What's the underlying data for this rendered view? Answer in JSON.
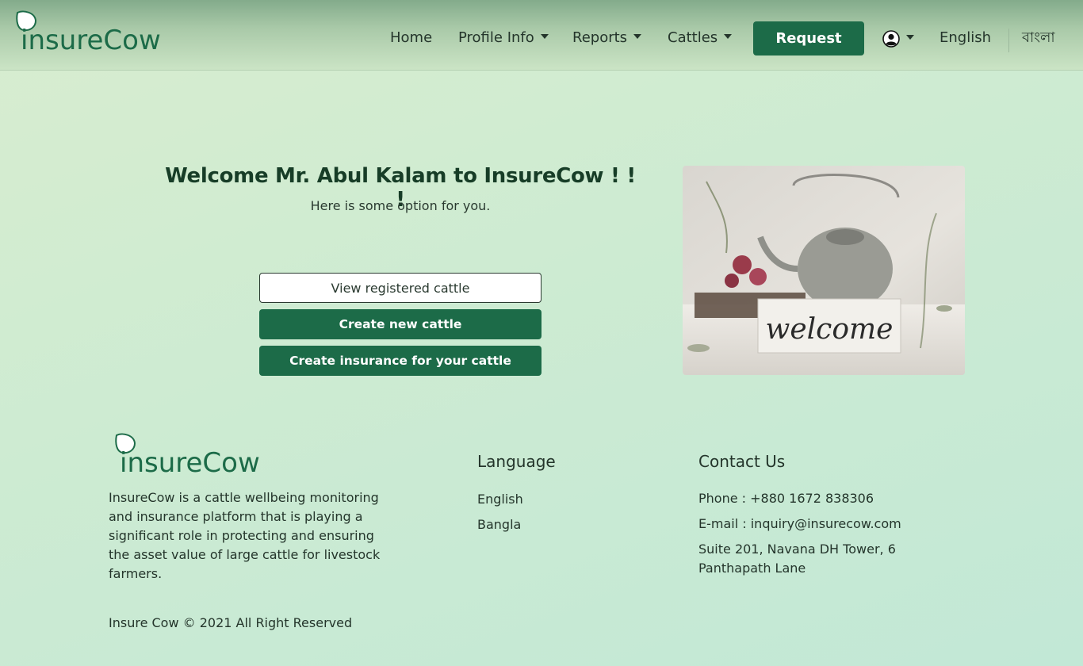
{
  "brand": {
    "logo_text": "insureCow"
  },
  "nav": {
    "home": "Home",
    "profile": "Profile Info",
    "reports": "Reports",
    "cattles": "Cattles",
    "request": "Request",
    "lang_english": "English",
    "lang_bangla": "বাংলা"
  },
  "welcome": {
    "title": "Welcome Mr. Abul Kalam to InsureCow ! ! !",
    "subtitle": "Here is some option for you.",
    "options": [
      "View registered cattle",
      "Create new cattle",
      "Create insurance for your cattle"
    ],
    "image_text": "welcome"
  },
  "footer": {
    "description": "InsureCow is a cattle wellbeing monitoring and insurance platform that is playing a significant role in protecting and ensuring the asset value of large cattle for livestock farmers.",
    "language_heading": "Language",
    "language_links": [
      "English",
      "Bangla"
    ],
    "contact_heading": "Contact Us",
    "phone": "Phone : +880 1672 838306",
    "email": "E-mail : inquiry@insurecow.com",
    "address": "Suite 201, Navana DH Tower, 6 Panthapath Lane",
    "copyright": "Insure Cow © 2021 All Right Reserved"
  },
  "colors": {
    "brand_green": "#1c6b48",
    "text_dark": "#24352b",
    "background": "#cdebd2"
  },
  "icons": {
    "user": "user-avatar-icon",
    "caret": "chevron-down-icon",
    "cow": "cow-head-icon",
    "leaf": "leaf-icon"
  }
}
